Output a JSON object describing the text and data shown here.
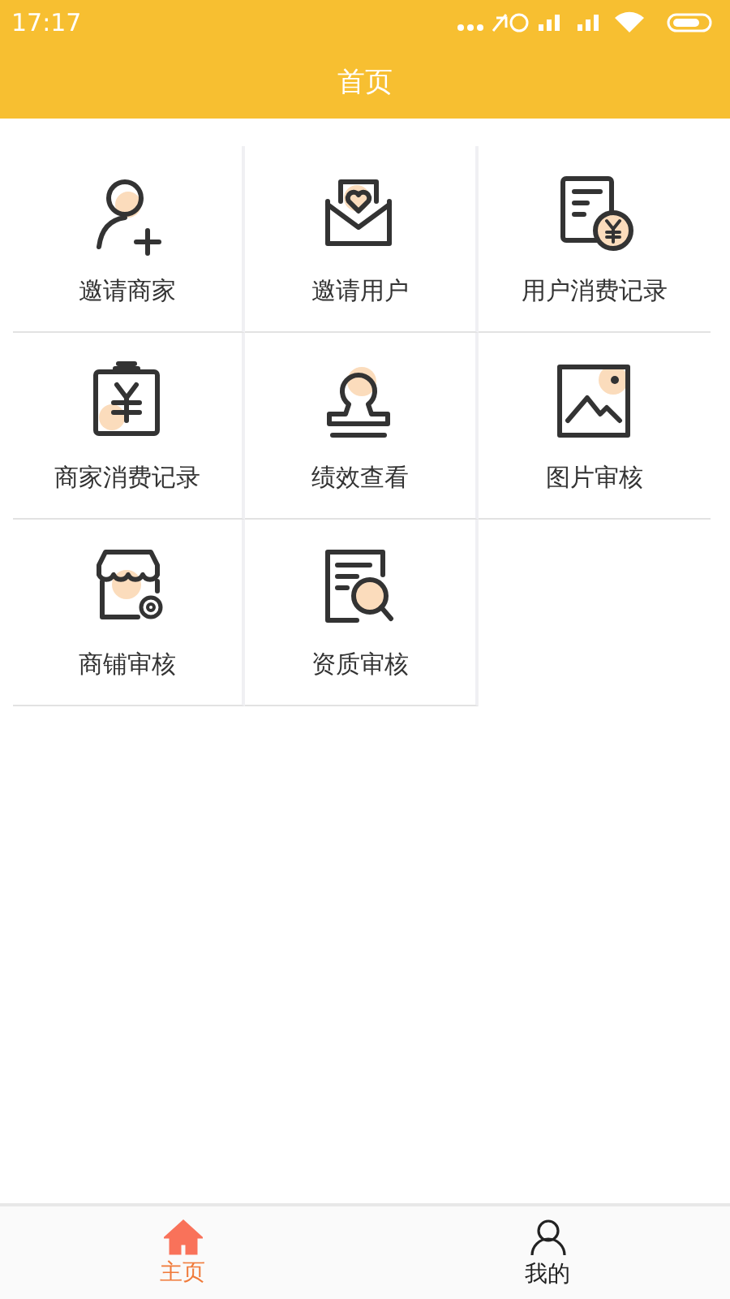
{
  "status_bar": {
    "time": "17:17"
  },
  "header": {
    "title": "首页"
  },
  "menu": [
    {
      "label": "邀请商家"
    },
    {
      "label": "邀请用户"
    },
    {
      "label": "用户消费记录"
    },
    {
      "label": "商家消费记录"
    },
    {
      "label": "绩效查看"
    },
    {
      "label": "图片审核"
    },
    {
      "label": "商铺审核"
    },
    {
      "label": "资质审核"
    }
  ],
  "tab_bar": [
    {
      "label": "主页",
      "selected": true
    },
    {
      "label": "我的",
      "selected": false
    }
  ]
}
